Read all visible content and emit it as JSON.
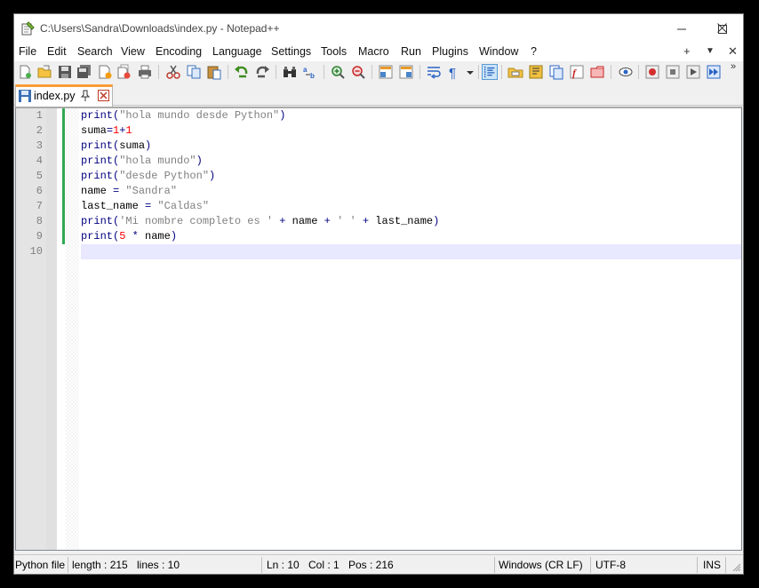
{
  "window": {
    "title": "C:\\Users\\Sandra\\Downloads\\index.py - Notepad++"
  },
  "menu": {
    "items": [
      "File",
      "Edit",
      "Search",
      "View",
      "Encoding",
      "Language",
      "Settings",
      "Tools",
      "Macro",
      "Run",
      "Plugins",
      "Window",
      "?"
    ],
    "right": [
      "+",
      "▼",
      "✕"
    ]
  },
  "toolbar": {
    "icons": [
      "new-file-icon",
      "open-file-icon",
      "save-icon",
      "save-all-icon",
      "close-icon",
      "close-all-icon",
      "print-icon",
      "cut-icon",
      "copy-icon",
      "paste-icon",
      "undo-icon",
      "redo-icon",
      "find-icon",
      "replace-icon",
      "zoom-in-icon",
      "zoom-out-icon",
      "sync-vertical-icon",
      "sync-horizontal-icon",
      "word-wrap-icon",
      "show-all-chars-icon",
      "indent-guide-icon",
      "folder-as-workspace-icon",
      "doc-map-icon",
      "doc-list-icon",
      "function-list-icon",
      "folder-icon",
      "monitoring-icon",
      "record-macro-icon",
      "stop-macro-icon",
      "play-macro-icon",
      "run-macro-multiple-icon"
    ],
    "more": "»"
  },
  "tab": {
    "label": "index.py"
  },
  "editor": {
    "lines": [
      {
        "num": "1",
        "html": "print(\"hola mundo desde Python\")"
      },
      {
        "num": "2",
        "html": "suma=1+1"
      },
      {
        "num": "3",
        "html": "print(suma)"
      },
      {
        "num": "4",
        "html": "print(\"hola mundo\")"
      },
      {
        "num": "5",
        "html": "print(\"desde Python\")"
      },
      {
        "num": "6",
        "html": "name = \"Sandra\""
      },
      {
        "num": "7",
        "html": "last_name = \"Caldas\""
      },
      {
        "num": "8",
        "html": "print('Mi nombre completo es ' + name + ' ' + last_name)"
      },
      {
        "num": "9",
        "html": "print(5 * name)"
      },
      {
        "num": "10",
        "html": ""
      }
    ]
  },
  "status": {
    "file_type": "Python file",
    "length": "length : 215",
    "lines": "lines : 10",
    "ln": "Ln : 10",
    "col": "Col : 1",
    "pos": "Pos : 216",
    "eol": "Windows (CR LF)",
    "encoding": "UTF-8",
    "mode": "INS"
  }
}
